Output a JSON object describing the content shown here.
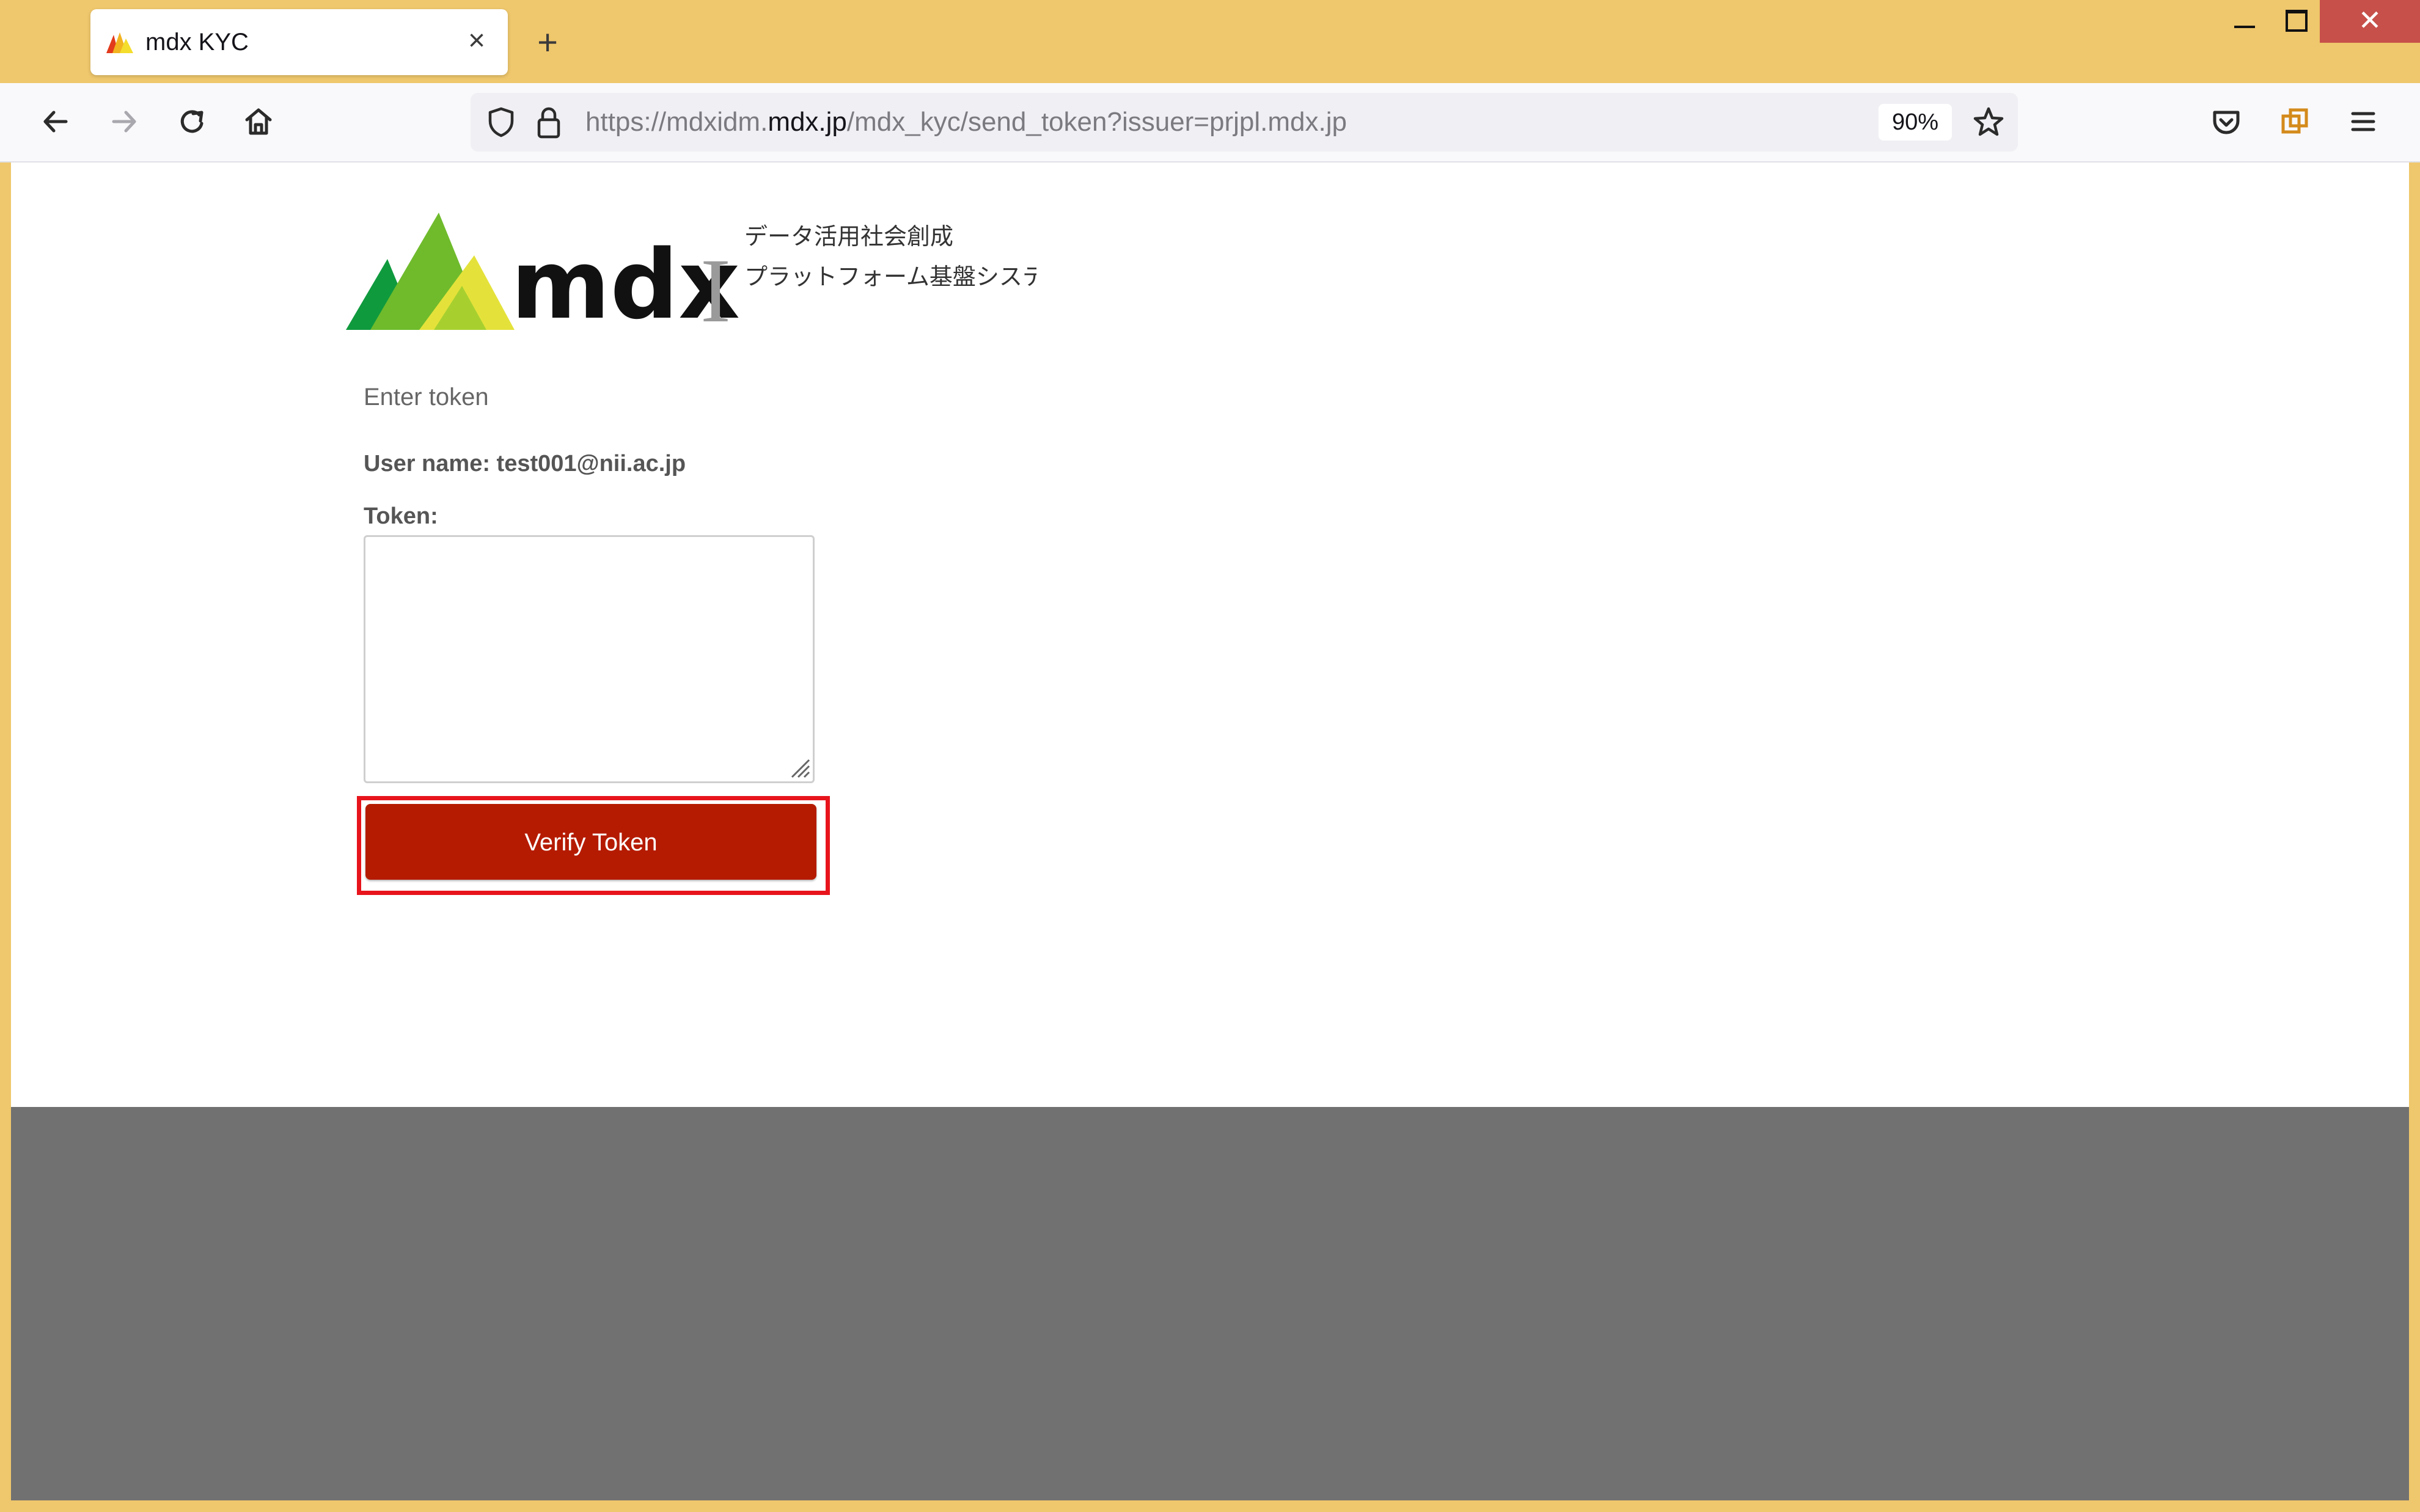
{
  "browser": {
    "tab": {
      "title": "mdx KYC",
      "close_glyph": "×"
    },
    "new_tab_glyph": "+",
    "window_controls": {
      "close_glyph": "✕"
    },
    "url": {
      "prefix": "https://mdxidm.",
      "domain": "mdx.jp",
      "path": "/mdx_kyc/send_token?issuer=prjpl.mdx.jp"
    },
    "zoom": "90%",
    "icons": [
      "back-arrow-icon",
      "forward-arrow-icon",
      "reload-icon",
      "home-icon",
      "shield-icon",
      "lock-icon",
      "star-icon",
      "pocket-icon",
      "extensions-icon",
      "menu-icon"
    ]
  },
  "logo": {
    "wordmark": "mdx",
    "numeral": "I",
    "tagline_line1": "データ活用社会創成",
    "tagline_line2": "プラットフォーム基盤システム"
  },
  "form": {
    "heading": "Enter token",
    "user_name": "User name: test001@nii.ac.jp",
    "token_label": "Token:",
    "token_value": "",
    "submit_label": "Verify Token"
  },
  "colors": {
    "window_frame": "#efc76c",
    "close_button": "#c7504a",
    "submit_button": "#b51b00",
    "highlight": "#e8141c",
    "footer": "#717171"
  }
}
